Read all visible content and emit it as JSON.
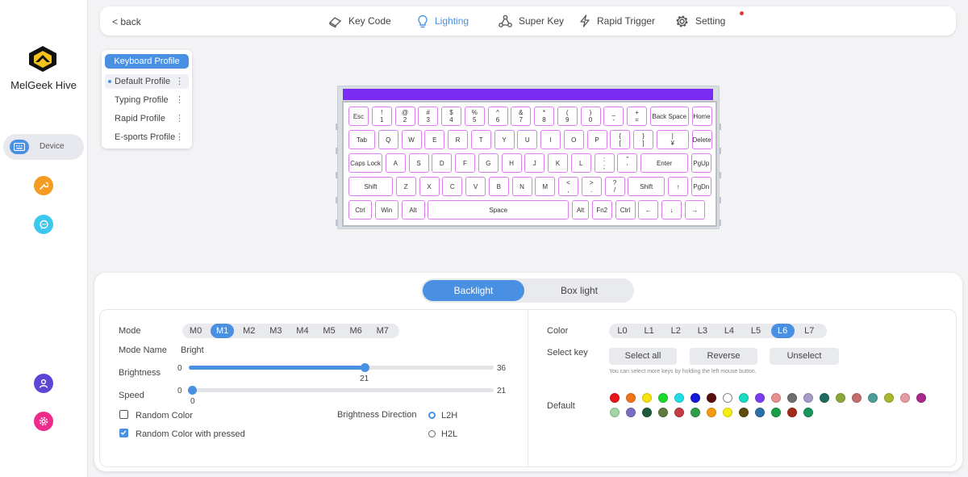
{
  "app": {
    "brand": "MelGeek Hive",
    "nav_device": "Device",
    "accent": "#4a90e2"
  },
  "topnav": {
    "back": "< back",
    "tabs": [
      {
        "label": "Key Code",
        "icon": "keycap-icon"
      },
      {
        "label": "Lighting",
        "icon": "bulb-icon"
      },
      {
        "label": "Super Key",
        "icon": "nodes-icon"
      },
      {
        "label": "Rapid Trigger",
        "icon": "bolt-icon"
      },
      {
        "label": "Setting",
        "icon": "gear-icon"
      }
    ],
    "active_tab": "Lighting"
  },
  "profiles": {
    "header": "Keyboard Profile",
    "items": [
      "Default Profile",
      "Typing Profile",
      "Rapid Profile",
      "E-sports Profile"
    ],
    "selected": "Default Profile"
  },
  "keyboard": {
    "rows": [
      [
        "Esc",
        "!\n1",
        "@\n2",
        "#\n3",
        "$\n4",
        "%\n5",
        "^\n6",
        "&\n7",
        "*\n8",
        "(\n9",
        ")\n0",
        "_\n-",
        "+\n=",
        "Back Space",
        "Home"
      ],
      [
        "Tab",
        "Q",
        "W",
        "E",
        "R",
        "T",
        "Y",
        "U",
        "I",
        "O",
        "P",
        "{\n[",
        "}\n]",
        "|\n¥",
        "Delete"
      ],
      [
        "Caps Lock",
        "A",
        "S",
        "D",
        "F",
        "G",
        "H",
        "J",
        "K",
        "L",
        ":\n;",
        "\"\n'",
        "Enter",
        "PgUp"
      ],
      [
        "Shift",
        "Z",
        "X",
        "C",
        "V",
        "B",
        "N",
        "M",
        "<\n,",
        ">\n.",
        "?\n/",
        "Shift",
        "↑",
        "PgDn"
      ],
      [
        "Ctrl",
        "Win",
        "Alt",
        "Space",
        "Alt",
        "Fn2",
        "Ctrl",
        "←",
        "↓",
        "→"
      ]
    ],
    "light_bar_color": "#7a2cf5",
    "key_border_color": "#dd7df0"
  },
  "lighting": {
    "toggle": [
      "Backlight",
      "Box light"
    ],
    "toggle_active": "Backlight",
    "mode_label": "Mode",
    "modes": [
      "M0",
      "M1",
      "M2",
      "M3",
      "M4",
      "M5",
      "M6",
      "M7"
    ],
    "mode_active": "M1",
    "mode_name_label": "Mode Name",
    "mode_name": "Bright",
    "brightness_label": "Brightness",
    "brightness_min": "0",
    "brightness_max": "36",
    "brightness_value": "21",
    "speed_label": "Speed",
    "speed_min": "0",
    "speed_max": "21",
    "speed_value": "0",
    "random_color_label": "Random Color",
    "random_color_checked": false,
    "random_pressed_label": "Random Color with pressed",
    "random_pressed_checked": true,
    "direction_label": "Brightness Direction",
    "directions": [
      "L2H",
      "H2L"
    ],
    "direction_active": "L2H",
    "color_label": "Color",
    "layers": [
      "L0",
      "L1",
      "L2",
      "L3",
      "L4",
      "L5",
      "L6",
      "L7"
    ],
    "layer_active": "L6",
    "select_key_label": "Select key",
    "buttons": [
      "Select all",
      "Reverse",
      "Unselect"
    ],
    "hint": "You can select more keys by holding the left mouse button.",
    "default_label": "Default",
    "palette_row1": [
      "#e8151b",
      "#f07417",
      "#f5e30e",
      "#1ed82e",
      "#22dde6",
      "#1418d8",
      "#5a0d0d",
      "#ffffff",
      "#17dcc1",
      "#7b3cf0",
      "#e88f8f",
      "#6e6e6e",
      "#a69bc4",
      "#1e6b5f",
      "#8aa83a",
      "#c46d6d",
      "#4c9e97",
      "#a8b92e",
      "#e59ba3",
      "#a8288c"
    ],
    "palette_row2": [
      "#a2d4a6",
      "#7a6cc2",
      "#1d5a3b",
      "#5e7a3e",
      "#c33c45",
      "#2f9c4a",
      "#f59b12",
      "#f4ed12",
      "#5c4a0e",
      "#2c6fa8",
      "#1a9e48",
      "#a02a1a",
      "#18945a"
    ]
  }
}
